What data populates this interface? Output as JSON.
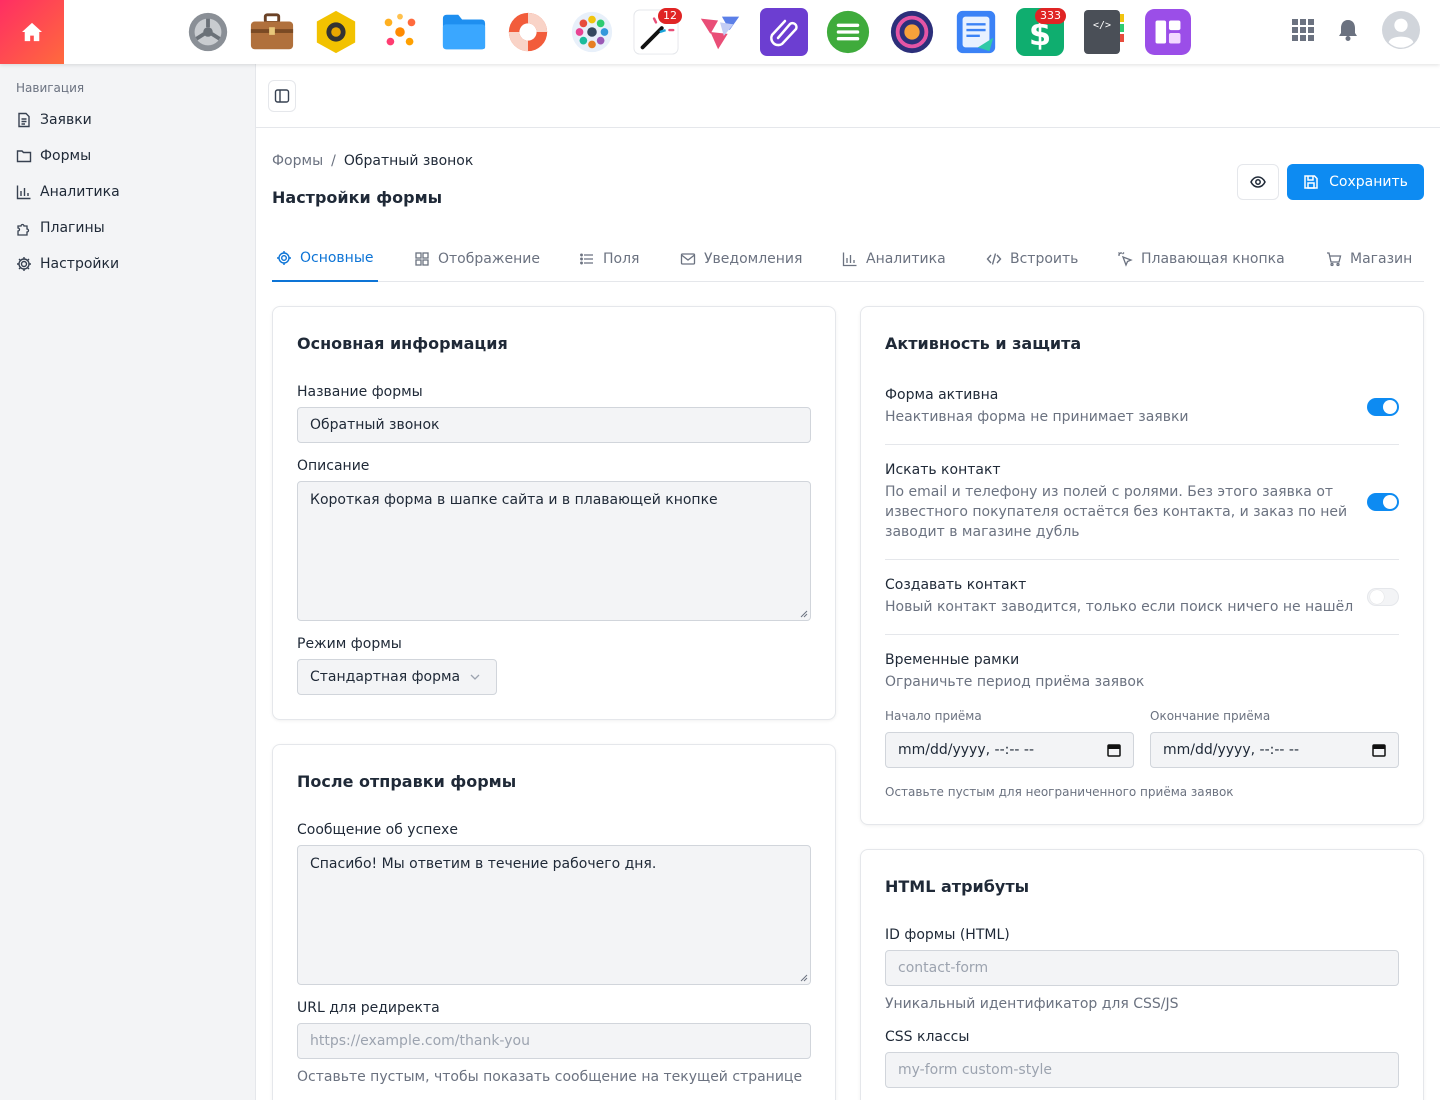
{
  "apps": [
    {
      "name": "settings-app-icon",
      "badge": ""
    },
    {
      "name": "briefcase-app-icon",
      "badge": ""
    },
    {
      "name": "camera-app-icon",
      "badge": ""
    },
    {
      "name": "sparkles-app-icon",
      "badge": ""
    },
    {
      "name": "folder-app-icon",
      "badge": ""
    },
    {
      "name": "lifebuoy-app-icon",
      "badge": ""
    },
    {
      "name": "mosaic-app-icon",
      "badge": ""
    },
    {
      "name": "magic-wand-app-icon",
      "badge": "12"
    },
    {
      "name": "paper-plane-app-icon",
      "badge": ""
    },
    {
      "name": "paperclip-app-icon",
      "badge": ""
    },
    {
      "name": "menu-app-icon",
      "badge": ""
    },
    {
      "name": "media-app-icon",
      "badge": ""
    },
    {
      "name": "docs-app-icon",
      "badge": ""
    },
    {
      "name": "dollar-app-icon",
      "badge": "333"
    },
    {
      "name": "code-app-icon",
      "badge": ""
    },
    {
      "name": "layout-app-icon",
      "badge": ""
    }
  ],
  "sidebar": {
    "title": "Навигация",
    "items": [
      {
        "label": "Заявки",
        "icon": "document-icon"
      },
      {
        "label": "Формы",
        "icon": "folder-icon"
      },
      {
        "label": "Аналитика",
        "icon": "bar-chart-icon"
      },
      {
        "label": "Плагины",
        "icon": "puzzle-icon"
      },
      {
        "label": "Настройки",
        "icon": "gear-icon"
      }
    ]
  },
  "breadcrumb": {
    "parent": "Формы",
    "separator": "/",
    "current": "Обратный звонок"
  },
  "page_title": "Настройки формы",
  "actions": {
    "save_label": "Сохранить"
  },
  "tabs": [
    {
      "label": "Основные"
    },
    {
      "label": "Отображение"
    },
    {
      "label": "Поля"
    },
    {
      "label": "Уведомления"
    },
    {
      "label": "Аналитика"
    },
    {
      "label": "Встроить"
    },
    {
      "label": "Плавающая кнопка"
    },
    {
      "label": "Магазин"
    }
  ],
  "basic_info": {
    "title": "Основная информация",
    "name_label": "Название формы",
    "name_value": "Обратный звонок",
    "description_label": "Описание",
    "description_value": "Короткая форма в шапке сайта и в плавающей кнопке",
    "mode_label": "Режим формы",
    "mode_value": "Стандартная форма"
  },
  "after_submit": {
    "title": "После отправки формы",
    "success_label": "Сообщение об успехе",
    "success_value": "Спасибо! Мы ответим в течение рабочего дня.",
    "redirect_label": "URL для редиректа",
    "redirect_placeholder": "https://example.com/thank-you",
    "redirect_help": "Оставьте пустым, чтобы показать сообщение на текущей странице"
  },
  "activity": {
    "title": "Активность и защита",
    "active_label": "Форма активна",
    "active_help": "Неактивная форма не принимает заявки",
    "search_label": "Искать контакт",
    "search_help_1": "По email и телефону из полей с ролями. Без этого заявка от",
    "search_help_2": "известного покупателя остаётся без контакта, и заказ по ней",
    "search_help_3": "заводит в магазине дубль",
    "create_label": "Создавать контакт",
    "create_help": "Новый контакт заводится, только если поиск ничего не нашёл",
    "time_label": "Временные рамки",
    "time_help": "Ограничьте период приёма заявок",
    "start_label": "Начало приёма",
    "end_label": "Окончание приёма",
    "date_placeholder": "mm/dd/yyyy, --:-- --",
    "date_help": "Оставьте пустым для неограниченного приёма заявок"
  },
  "html_attrs": {
    "title": "HTML атрибуты",
    "id_label": "ID формы (HTML)",
    "id_placeholder": "contact-form",
    "id_help": "Уникальный идентификатор для CSS/JS",
    "css_label": "CSS классы",
    "css_placeholder": "my-form custom-style"
  }
}
